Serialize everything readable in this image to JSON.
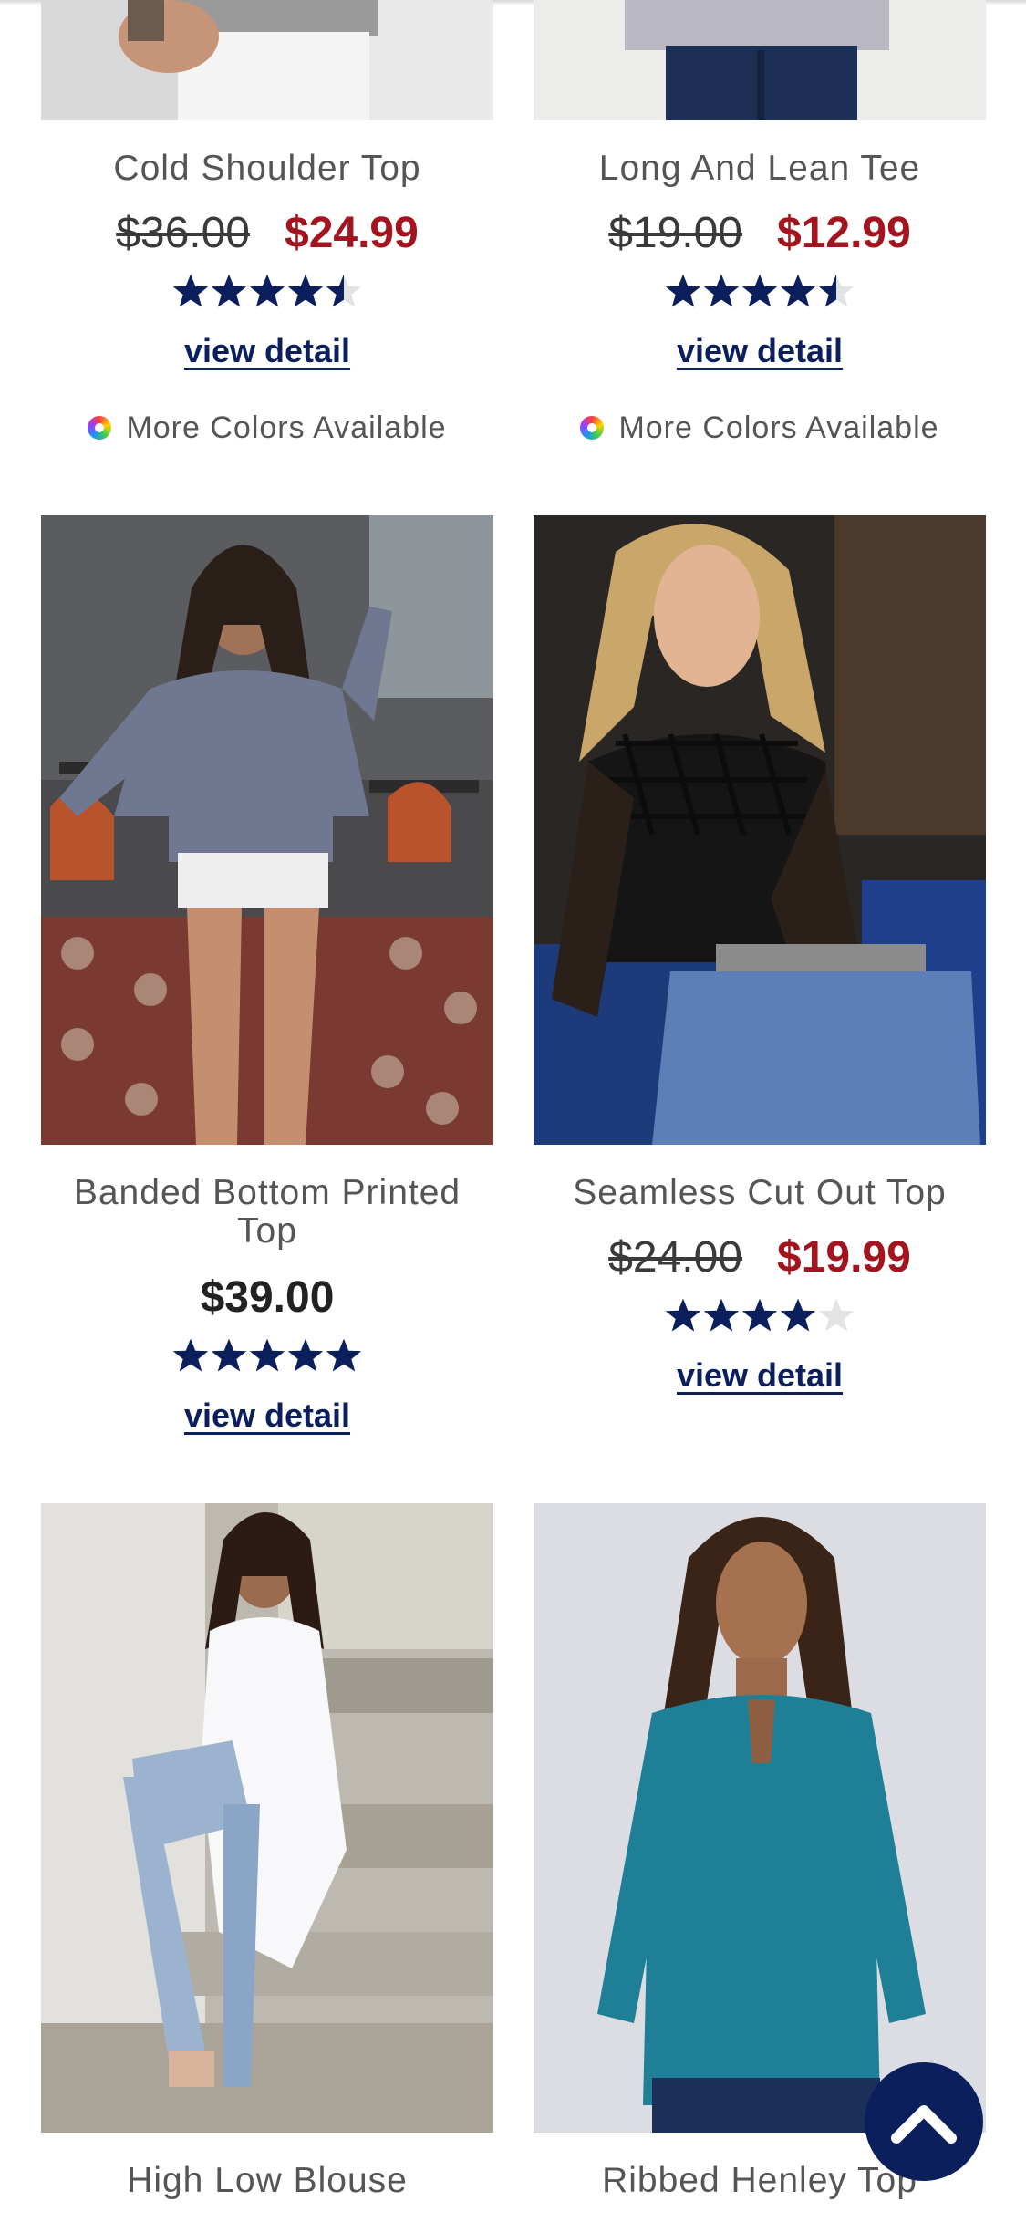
{
  "products": [
    {
      "name": "Cold Shoulder Top",
      "was_price": "$36.00",
      "price": "$24.99",
      "rating": 4.5,
      "detail_label": "view detail",
      "more_colors": "More Colors Available"
    },
    {
      "name": "Long And Lean Tee",
      "was_price": "$19.00",
      "price": "$12.99",
      "rating": 4.5,
      "detail_label": "view detail",
      "more_colors": "More Colors Available"
    },
    {
      "name": "Banded Bottom Printed Top",
      "price": "$39.00",
      "rating": 5,
      "detail_label": "view detail"
    },
    {
      "name": "Seamless Cut Out Top",
      "was_price": "$24.00",
      "price": "$19.99",
      "rating": 4,
      "detail_label": "view detail"
    },
    {
      "name": "High Low Blouse"
    },
    {
      "name": "Ribbed Henley Top"
    }
  ],
  "colors": {
    "sale_price": "#a3141e",
    "link": "#0b1f5c",
    "star": "#0b1f5c",
    "back_to_top": "#0b1f5c"
  },
  "back_to_top_icon": "chevron-up-icon"
}
